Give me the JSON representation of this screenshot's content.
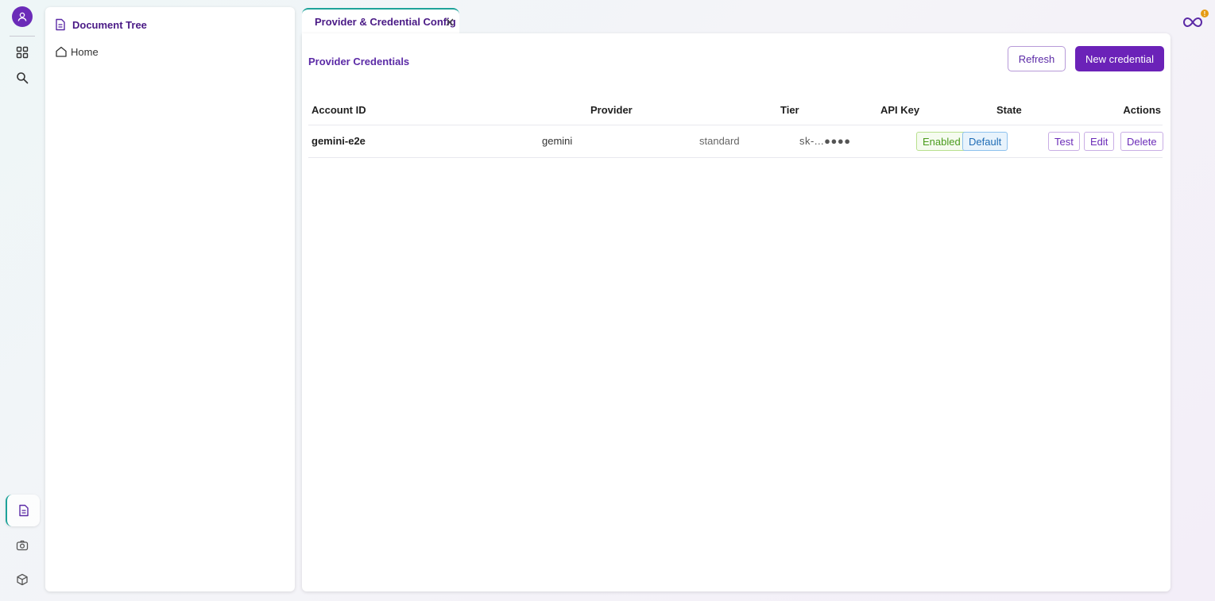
{
  "rail": {
    "icons": [
      "user-icon",
      "grid-icon",
      "search-icon",
      "document-icon",
      "camera-icon",
      "cube-icon"
    ]
  },
  "tree": {
    "title": "Document Tree",
    "items": [
      {
        "label": "Home",
        "icon": "home-icon"
      }
    ]
  },
  "tab": {
    "label": "Provider & Credential Config"
  },
  "main": {
    "section_title": "Provider Credentials",
    "refresh_label": "Refresh",
    "new_label": "New credential"
  },
  "table": {
    "columns": [
      "Account ID",
      "Provider",
      "Tier",
      "API Key",
      "State",
      "Actions"
    ],
    "rows": [
      {
        "account_id": "gemini-e2e",
        "provider": "gemini",
        "tier": "standard",
        "api_key": "sk-...●●●●",
        "state_badges": [
          "Enabled",
          "Default"
        ],
        "actions": [
          "Test",
          "Edit",
          "Delete"
        ]
      }
    ]
  },
  "notification": {
    "count": "!"
  },
  "colors": {
    "accent": "#6b22b8",
    "teal": "#1ea39a",
    "enabled": "#4a9b1c",
    "default": "#1f6cb5",
    "notify": "#e59b14"
  }
}
